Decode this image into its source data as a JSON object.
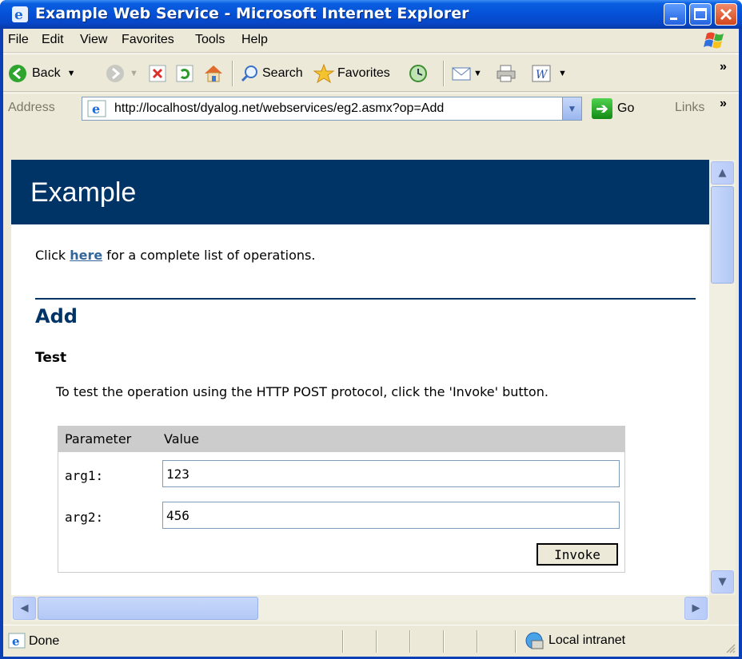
{
  "window": {
    "title": "Example Web Service - Microsoft Internet Explorer"
  },
  "menubar": {
    "items": [
      "File",
      "Edit",
      "View",
      "Favorites",
      "Tools",
      "Help"
    ]
  },
  "toolbar": {
    "back_label": "Back",
    "search_label": "Search",
    "favorites_label": "Favorites",
    "overflow": "»"
  },
  "addressbar": {
    "label": "Address",
    "url": "http://localhost/dyalog.net/webservices/eg2.asmx?op=Add",
    "go_label": "Go",
    "links_label": "Links",
    "overflow": "»"
  },
  "page": {
    "banner_title": "Example",
    "intro_prefix": "Click ",
    "intro_link": "here",
    "intro_suffix": " for a complete list of operations.",
    "operation_title": "Add",
    "test_heading": "Test",
    "test_description": "To test the operation using the HTTP POST protocol, click the 'Invoke' button.",
    "table": {
      "col_parameter": "Parameter",
      "col_value": "Value",
      "rows": [
        {
          "label": "arg1:",
          "value": "123"
        },
        {
          "label": "arg2:",
          "value": "456"
        }
      ],
      "invoke_label": "Invoke"
    }
  },
  "statusbar": {
    "status": "Done",
    "zone": "Local intranet"
  },
  "colors": {
    "banner": "#003366",
    "heading": "#003366",
    "link": "#336699"
  }
}
